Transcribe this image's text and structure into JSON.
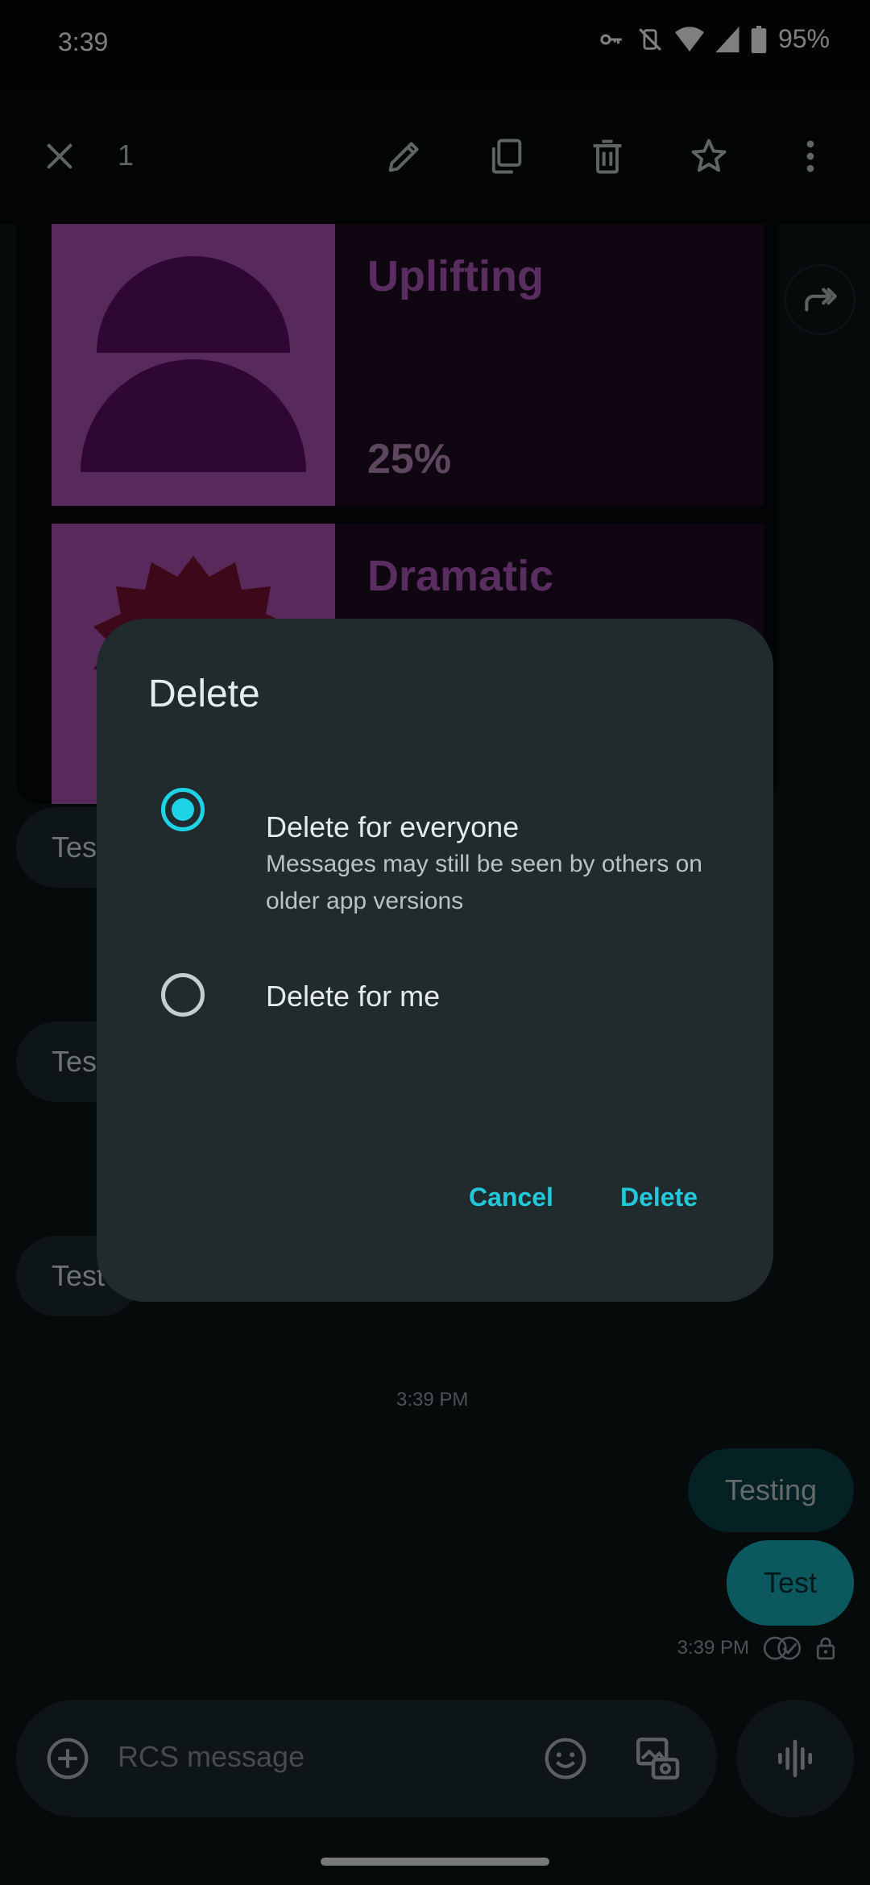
{
  "status_bar": {
    "time": "3:39",
    "battery": "95%",
    "icons": [
      "vpn-key-icon",
      "vibrate-off-icon",
      "wifi-icon",
      "cell-signal-icon",
      "battery-icon"
    ]
  },
  "action_bar": {
    "selected_count": "1",
    "icons": [
      "close-icon",
      "edit-icon",
      "copy-icon",
      "delete-icon",
      "star-icon",
      "more-icon"
    ]
  },
  "conversation": {
    "poll_cards": [
      {
        "title": "Uplifting",
        "percent": "25%"
      },
      {
        "title": "Dramatic",
        "percent": ""
      }
    ],
    "incoming": [
      {
        "text": "Test"
      },
      {
        "text": "Test"
      },
      {
        "text": "Test"
      }
    ],
    "timestamp": "3:39 PM",
    "outgoing": [
      {
        "text": "Testing"
      },
      {
        "text": "Test"
      }
    ],
    "sent_time": "3:39 PM"
  },
  "composer": {
    "placeholder": "RCS message"
  },
  "dialog": {
    "title": "Delete",
    "options": [
      {
        "title": "Delete for everyone",
        "subtitle": "Messages may still be seen by others on older app versions",
        "selected": true
      },
      {
        "title": "Delete for me",
        "subtitle": "",
        "selected": false
      }
    ],
    "cancel_label": "Cancel",
    "delete_label": "Delete"
  },
  "colors": {
    "accent": "#1ed3e6",
    "poll_image": "#b154b8",
    "poll_title": "#b25bc0",
    "bubble_out": "#17b3bd"
  }
}
